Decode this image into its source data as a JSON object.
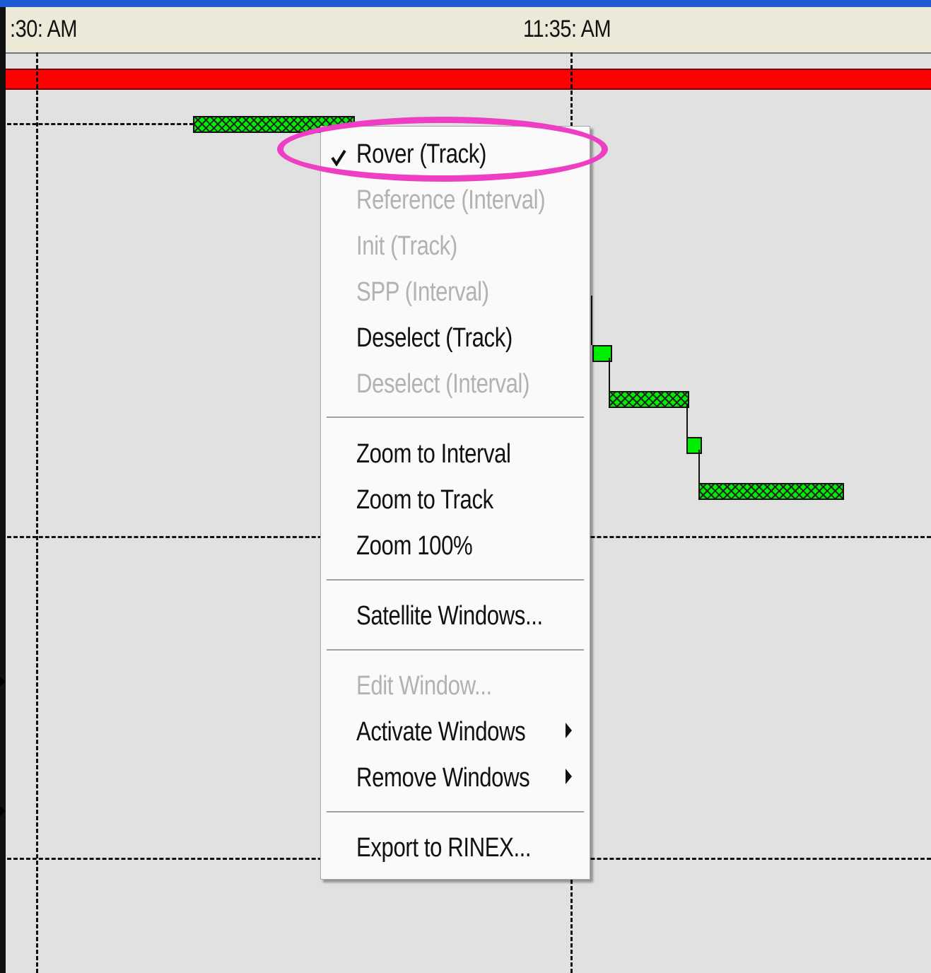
{
  "ruler": {
    "labels": [
      ":30: AM",
      "11:35: AM"
    ]
  },
  "menu": {
    "items": [
      {
        "label": "Rover (Track)",
        "enabled": true,
        "checked": true
      },
      {
        "label": "Reference (Interval)",
        "enabled": false
      },
      {
        "label": "Init (Track)",
        "enabled": false
      },
      {
        "label": "SPP (Interval)",
        "enabled": false
      },
      {
        "label": "Deselect (Track)",
        "enabled": true
      },
      {
        "label": "Deselect (Interval)",
        "enabled": false
      },
      {
        "label": "Zoom to Interval",
        "enabled": true
      },
      {
        "label": "Zoom to Track",
        "enabled": true
      },
      {
        "label": "Zoom 100%",
        "enabled": true
      },
      {
        "label": "Satellite Windows...",
        "enabled": true
      },
      {
        "label": "Edit Window...",
        "enabled": false
      },
      {
        "label": "Activate Windows",
        "enabled": true,
        "submenu": true
      },
      {
        "label": "Remove Windows",
        "enabled": true,
        "submenu": true
      },
      {
        "label": "Export to RINEX...",
        "enabled": true
      }
    ]
  },
  "colors": {
    "track_bar": "#ff0000",
    "satellite_window": "#00ee00",
    "highlight": "#ee3fc4",
    "background": "#e1e1e1"
  }
}
